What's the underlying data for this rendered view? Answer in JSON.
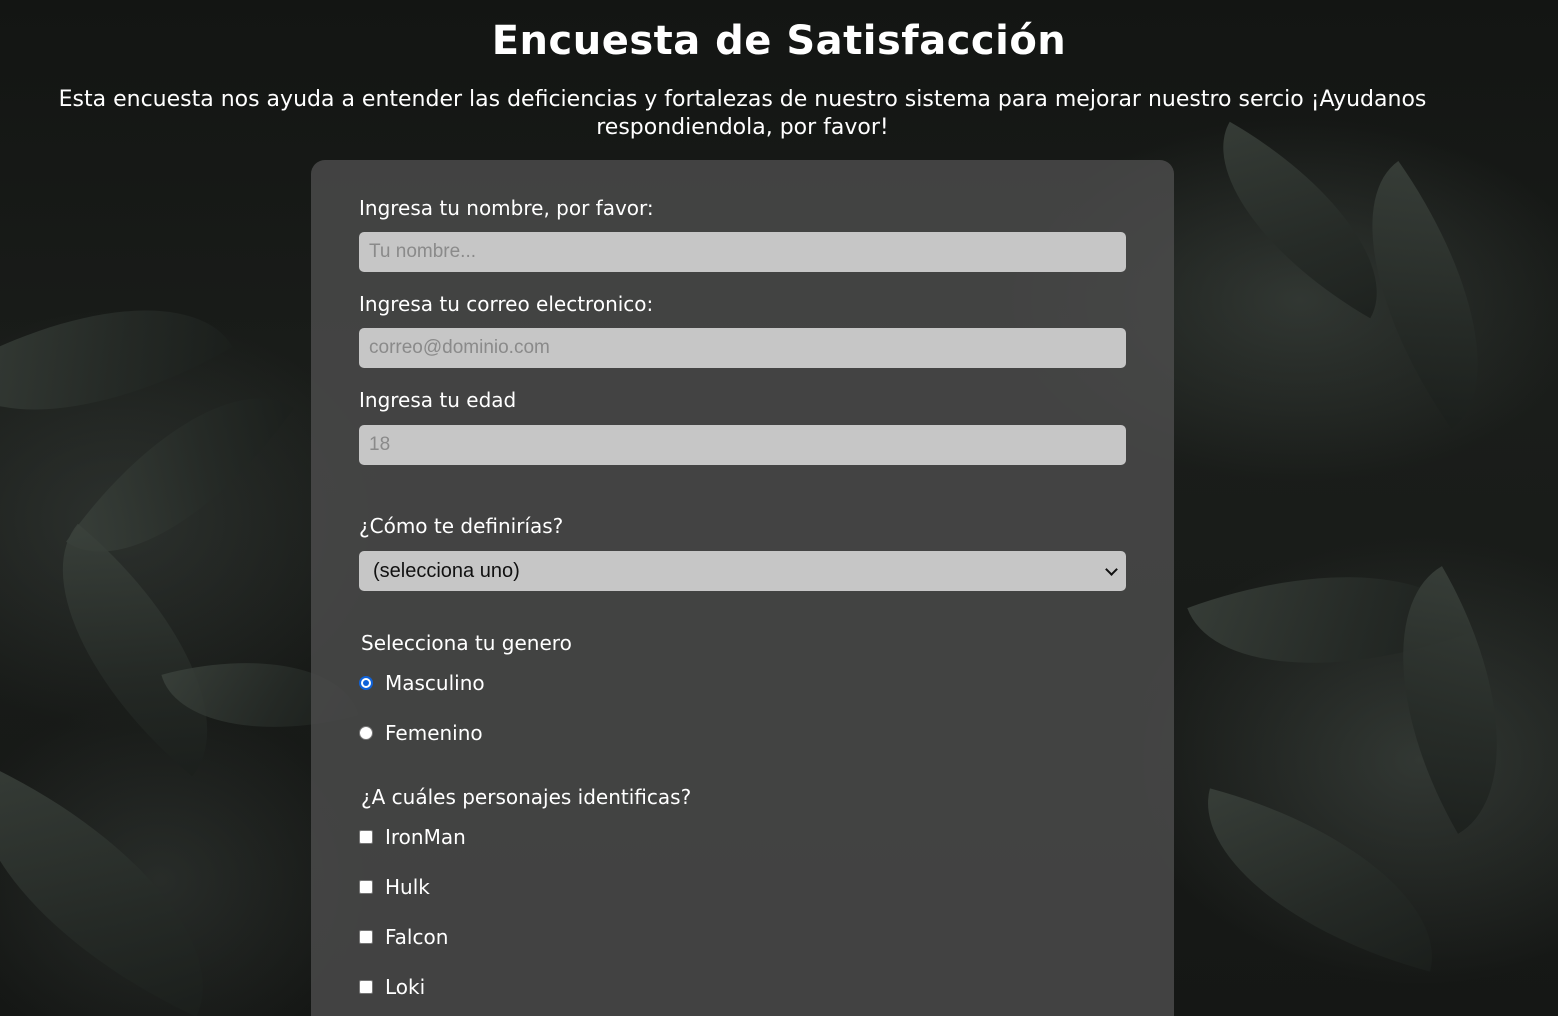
{
  "header": {
    "title": "Encuesta de Satisfacción",
    "description": "Esta encuesta nos ayuda a entender las deficiencias y fortalezas de nuestro sistema para mejorar nuestro sercio ¡Ayudanos respondiendola, por favor!"
  },
  "form": {
    "name": {
      "label": "Ingresa tu nombre, por favor:",
      "placeholder": "Tu nombre..."
    },
    "email": {
      "label": "Ingresa tu correo electronico:",
      "placeholder": "correo@dominio.com"
    },
    "age": {
      "label": "Ingresa tu edad",
      "placeholder": "18"
    },
    "define": {
      "label": "¿Cómo te definirías?",
      "selected": "(selecciona uno)"
    },
    "gender": {
      "label": "Selecciona tu genero",
      "options": [
        "Masculino",
        "Femenino"
      ],
      "selected": "Masculino"
    },
    "characters": {
      "label": "¿A cuáles personajes identificas?",
      "options": [
        "IronMan",
        "Hulk",
        "Falcon",
        "Loki"
      ]
    }
  },
  "colors": {
    "radio_accent": "#0f62d9",
    "input_bg": "#c6c6c6"
  }
}
